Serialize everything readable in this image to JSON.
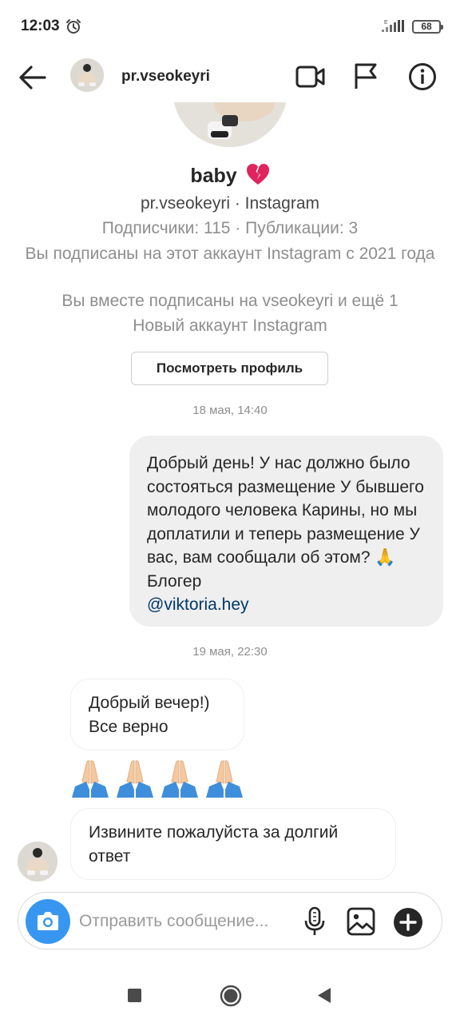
{
  "status_bar": {
    "time": "12:03",
    "battery": "68",
    "network_label": "E"
  },
  "header": {
    "username": "pr.vseokeyri"
  },
  "profile": {
    "name": "baby",
    "handle_line": "pr.vseokeyri · Instagram",
    "stats": "Подписчики: 115 · Публикации: 3",
    "following_since": "Вы подписаны на этот аккаунт Instagram с 2021 года",
    "mutual": "Вы вместе подписаны на vseokeyri и ещё 1",
    "new_account": "Новый аккаунт Instagram",
    "view_profile_button": "Посмотреть профиль"
  },
  "messages": {
    "timestamp_1": "18 мая, 14:40",
    "outgoing_1_text": "Добрый день! У нас должно было состояться размещение У бывшего молодого человека Карины, но мы доплатили и теперь размещение У вас, вам сообщали об этом? 🙏 Блогер",
    "outgoing_1_mention": "@viktoria.hey",
    "timestamp_2": "19 мая, 22:30",
    "incoming_1_line1": "Добрый вечер!)",
    "incoming_1_line2": "Все верно",
    "incoming_2_text": "Извините пожалуйста за долгий ответ"
  },
  "composer": {
    "placeholder": "Отправить сообщение..."
  },
  "colors": {
    "accent_blue": "#3797f0",
    "mention_blue": "#00376b",
    "outgoing_bubble": "#efefef",
    "secondary_text": "#8e8e8e",
    "heart_red": "#e0245e"
  },
  "icons": [
    "alarm-icon",
    "signal-icon",
    "back-arrow-icon",
    "video-call-icon",
    "flag-icon",
    "info-icon",
    "broken-heart-icon",
    "folded-hands-icon",
    "camera-icon",
    "microphone-icon",
    "gallery-icon",
    "plus-icon"
  ]
}
